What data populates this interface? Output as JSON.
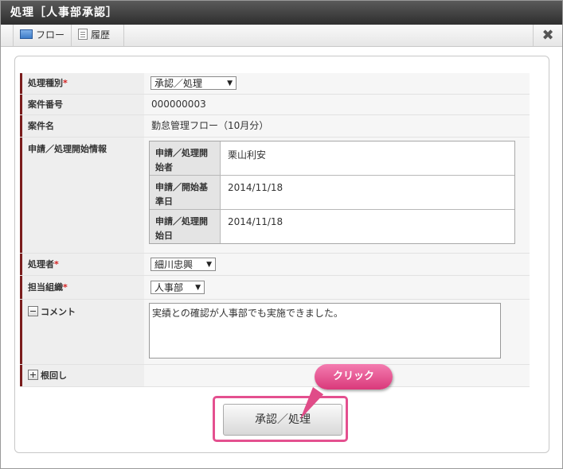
{
  "window": {
    "title": "処理［人事部承認］"
  },
  "toolbar": {
    "flow_label": "フロー",
    "history_label": "履歴"
  },
  "form": {
    "process_type": {
      "label": "処理種別",
      "required_mark": "*",
      "value": "承認／処理"
    },
    "case_number": {
      "label": "案件番号",
      "value": "000000003"
    },
    "case_name": {
      "label": "案件名",
      "value": "勤怠管理フロー（10月分）"
    },
    "start_info": {
      "label": "申請／処理開始情報",
      "rows": [
        {
          "label_line1": "申請／処理開",
          "label_line2": "始者",
          "value": "栗山利安"
        },
        {
          "label_line1": "申請／開始基",
          "label_line2": "準日",
          "value": "2014/11/18"
        },
        {
          "label_line1": "申請／処理開",
          "label_line2": "始日",
          "value": "2014/11/18"
        }
      ]
    },
    "processor": {
      "label": "処理者",
      "required_mark": "*",
      "value": "細川忠興"
    },
    "org": {
      "label": "担当組織",
      "required_mark": "*",
      "value": "人事部"
    },
    "comment": {
      "label": "コメント",
      "value": "実績との確認が人事部でも実施できました。"
    },
    "nemawashi": {
      "label": "根回し"
    }
  },
  "actions": {
    "submit_label": "承認／処理"
  },
  "annotation": {
    "callout_label": "クリック"
  },
  "colors": {
    "title_bg": "#3f3f3f",
    "label_border": "#7a1c1c",
    "highlight": "#e4508f",
    "required": "#d32020"
  }
}
